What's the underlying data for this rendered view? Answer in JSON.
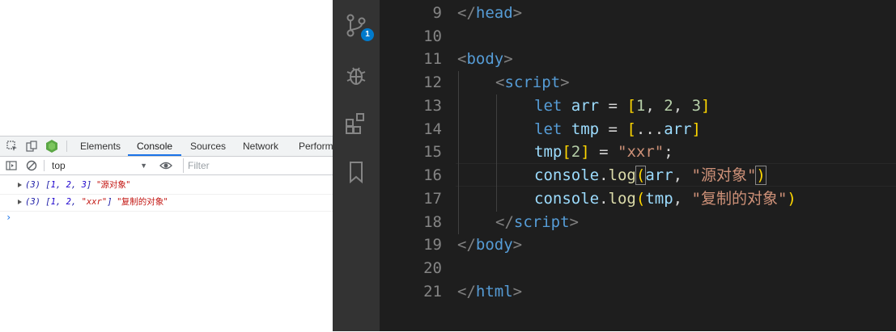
{
  "devtools": {
    "tabs": [
      "Elements",
      "Console",
      "Sources",
      "Network",
      "Perform"
    ],
    "active_tab": "Console",
    "context": "top",
    "filter_placeholder": "Filter",
    "logs": [
      {
        "count": "(3)",
        "open": "[",
        "a": "1",
        "b": "2",
        "c": "3",
        "close": "]",
        "label": "\"源对象\""
      },
      {
        "count": "(3)",
        "open": "[",
        "a": "1",
        "b": "2",
        "c": "\"xxr\"",
        "close": "]",
        "label": "\"复制的对象\""
      }
    ],
    "prompt": "›",
    "accent_color": "#1a73e8"
  },
  "activity_bar": {
    "badge": "1",
    "icons": [
      "source-control-icon",
      "debug-icon",
      "extensions-icon",
      "bookmark-icon"
    ]
  },
  "editor": {
    "line_numbers": [
      "9",
      "10",
      "11",
      "12",
      "13",
      "14",
      "15",
      "16",
      "17",
      "18",
      "19",
      "20",
      "21"
    ],
    "lines": {
      "l9": {
        "p1": "</",
        "t": "head",
        "p2": ">"
      },
      "l11": {
        "p1": "<",
        "t": "body",
        "p2": ">"
      },
      "l12": {
        "p1": "<",
        "t": "script",
        "p2": ">"
      },
      "l13": {
        "kw": "let",
        "v": "arr",
        "eq": " = ",
        "ob": "[",
        "a": "1",
        "c1": ", ",
        "b": "2",
        "c2": ", ",
        "c": "3",
        "cb": "]"
      },
      "l14": {
        "kw": "let",
        "v": "tmp",
        "eq": " = ",
        "ob": "[",
        "sp": "...",
        "v2": "arr",
        "cb": "]"
      },
      "l15": {
        "v": "tmp",
        "ob": "[",
        "n": "2",
        "cb": "]",
        "eq": " = ",
        "s": "\"xxr\"",
        "semi": ";"
      },
      "l16": {
        "v": "console",
        "dot": ".",
        "fn": "log",
        "op": "(",
        "a": "arr",
        "cm": ", ",
        "s": "\"源对象\"",
        "cp": ")"
      },
      "l17": {
        "v": "console",
        "dot": ".",
        "fn": "log",
        "op": "(",
        "a": "tmp",
        "cm": ", ",
        "s": "\"复制的对象\"",
        "cp": ")"
      },
      "l18": {
        "p1": "</",
        "t": "script",
        "p2": ">"
      },
      "l19": {
        "p1": "</",
        "t": "body",
        "p2": ">"
      },
      "l21": {
        "p1": "</",
        "t": "html",
        "p2": ">"
      }
    },
    "colors": {
      "background": "#1e1e1e",
      "tag": "#569cd6",
      "string": "#ce9178",
      "variable": "#9cdcfe",
      "number": "#b5cea8",
      "function": "#dcdcaa",
      "bracket": "#ffd700"
    }
  }
}
